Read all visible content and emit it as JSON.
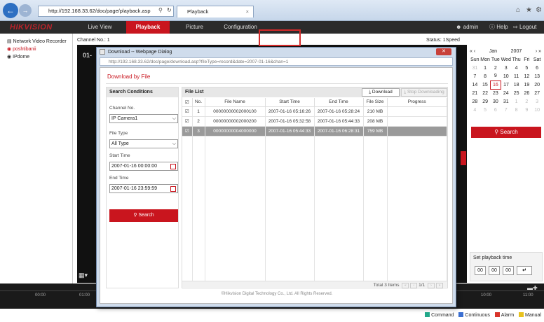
{
  "browser": {
    "url": "http://192.168.33.62/doc/page/playback.asp",
    "tab_title": "Playback",
    "search_icon": "search-icon",
    "refresh_icon": "refresh-icon"
  },
  "app": {
    "logo": "HIKVISION",
    "nav": [
      "Live View",
      "Playback",
      "Picture",
      "Configuration"
    ],
    "user": "admin",
    "help": "Help",
    "logout": "Logout"
  },
  "tree": {
    "root": "Network Video Recorder",
    "items": [
      "poshtibanii",
      "IPdome"
    ]
  },
  "main": {
    "channel": "Channel No.: 1",
    "status": "Status: 1Speed",
    "video_label": "01-"
  },
  "calendar": {
    "month": "Jan",
    "year": "2007",
    "weekdays": [
      "Sun",
      "Mon",
      "Tue",
      "Wed",
      "Thu",
      "Fri",
      "Sat"
    ],
    "weeks": [
      [
        "31",
        "1",
        "2",
        "3",
        "4",
        "5",
        "6"
      ],
      [
        "7",
        "8",
        "9",
        "10",
        "11",
        "12",
        "13"
      ],
      [
        "14",
        "15",
        "16",
        "17",
        "18",
        "19",
        "20"
      ],
      [
        "21",
        "22",
        "23",
        "24",
        "25",
        "26",
        "27"
      ],
      [
        "28",
        "29",
        "30",
        "31",
        "1",
        "2",
        "3"
      ],
      [
        "4",
        "5",
        "6",
        "7",
        "8",
        "9",
        "10"
      ]
    ],
    "selected": "16",
    "search_label": "Search"
  },
  "playback_time": {
    "label": "Set playback time",
    "hh": "00",
    "mm": "00",
    "ss": "00"
  },
  "timeline": {
    "ticks": [
      "00:00",
      "01:00",
      "10:00",
      "11:00"
    ]
  },
  "legend": [
    "Command",
    "Continuous",
    "Alarm",
    "Manual"
  ],
  "colors": {
    "accent": "#c9151e",
    "command": "#22a88a",
    "continuous": "#3b6fd1",
    "alarm": "#d9342b",
    "manual": "#e8c21e"
  },
  "dialog": {
    "title": "Download -- Webpage Dialog",
    "url": "http://192.168.33.62/doc/page/download.asp?fileType=record&date=2007-01-16&chan=1",
    "heading": "Download by File",
    "conditions_title": "Search Conditions",
    "channel_label": "Channel No.",
    "channel_value": "IP Camera1",
    "filetype_label": "File Type",
    "filetype_value": "All Type",
    "start_label": "Start Time",
    "start_value": "2007-01-16 00:00:00",
    "end_label": "End Time",
    "end_value": "2007-01-16 23:59:59",
    "search_label": "Search",
    "filelist_title": "File List",
    "download_label": "Download",
    "stop_label": "Stop Downloading",
    "columns": [
      "No.",
      "File Name",
      "Start Time",
      "End Time",
      "File Size",
      "Progress"
    ],
    "rows": [
      {
        "no": "1",
        "name": "00000000002000100",
        "start": "2007-01-16 05:16:26",
        "end": "2007-01-16 05:28:24",
        "size": "210 MB",
        "progress": ""
      },
      {
        "no": "2",
        "name": "00000000002000200",
        "start": "2007-01-16 05:32:58",
        "end": "2007-01-16 05:44:33",
        "size": "208 MB",
        "progress": ""
      },
      {
        "no": "3",
        "name": "00000000004000000",
        "start": "2007-01-16 05:44:33",
        "end": "2007-01-16 06:28:31",
        "size": "759 MB",
        "progress": ""
      }
    ],
    "total": "Total 3 Items",
    "page": "1/1",
    "footer": "©Hikvision Digital Technology Co., Ltd. All Rights Reserved."
  }
}
